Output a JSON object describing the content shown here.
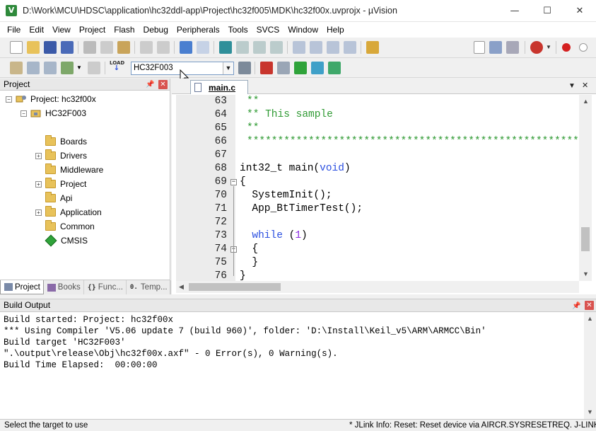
{
  "window": {
    "title": "D:\\Work\\MCU\\HDSC\\application\\hc32ddl-app\\Project\\hc32f005\\MDK\\hc32f00x.uvprojx - µVision",
    "app_icon_letter": "V"
  },
  "menu": [
    "File",
    "Edit",
    "View",
    "Project",
    "Flash",
    "Debug",
    "Peripherals",
    "Tools",
    "SVCS",
    "Window",
    "Help"
  ],
  "toolbar": {
    "target_value": "HC32F003",
    "load_label": "LOAD"
  },
  "project_panel": {
    "title": "Project",
    "root": "Project: hc32f00x",
    "target": "HC32F003",
    "groups": [
      {
        "label": "Boards",
        "expandable": false
      },
      {
        "label": "Drivers",
        "expandable": true
      },
      {
        "label": "Middleware",
        "expandable": false
      },
      {
        "label": "Project",
        "expandable": true
      },
      {
        "label": "Api",
        "expandable": false
      },
      {
        "label": "Application",
        "expandable": true
      },
      {
        "label": "Common",
        "expandable": false
      }
    ],
    "component": "CMSIS",
    "tabs": [
      "Project",
      "Books",
      "Func...",
      "Temp..."
    ]
  },
  "editor": {
    "file_tab": "main.c",
    "lines": [
      {
        "n": "63",
        "text": "**",
        "cls": "cmt"
      },
      {
        "n": "64",
        "text": "** This sample",
        "cls": "cmt"
      },
      {
        "n": "65",
        "text": "**",
        "cls": "cmt"
      },
      {
        "n": "66",
        "text": "******************************************************************************/",
        "cls": "cmt"
      },
      {
        "n": "67",
        "text": "",
        "cls": ""
      },
      {
        "n": "68",
        "text": "int32_t main(void)",
        "cls": "fn"
      },
      {
        "n": "69",
        "text": "{",
        "cls": ""
      },
      {
        "n": "70",
        "text": "  SystemInit();",
        "cls": ""
      },
      {
        "n": "71",
        "text": "  App_BtTimerTest();",
        "cls": ""
      },
      {
        "n": "72",
        "text": "",
        "cls": ""
      },
      {
        "n": "73",
        "text": "  while (1)",
        "cls": "while"
      },
      {
        "n": "74",
        "text": "  {",
        "cls": ""
      },
      {
        "n": "75",
        "text": "  }",
        "cls": ""
      },
      {
        "n": "76",
        "text": "}",
        "cls": ""
      }
    ]
  },
  "build_output": {
    "title": "Build Output",
    "lines": [
      "Build started: Project: hc32f00x",
      "*** Using Compiler 'V5.06 update 7 (build 960)', folder: 'D:\\Install\\Keil_v5\\ARM\\ARMCC\\Bin'",
      "Build target 'HC32F003'",
      "\".\\output\\release\\Obj\\hc32f00x.axf\" - 0 Error(s), 0 Warning(s).",
      "Build Time Elapsed:  00:00:00"
    ]
  },
  "status": {
    "left": "Select the target to use",
    "right": "* JLink Info: Reset: Reset device via AIRCR.SYSRESETREQ.   J-LINK / J-TRACE Cortex"
  },
  "colors": {
    "comment": "#2f9a33",
    "keyword": "#2b4fe0",
    "number": "#8a2be2"
  }
}
